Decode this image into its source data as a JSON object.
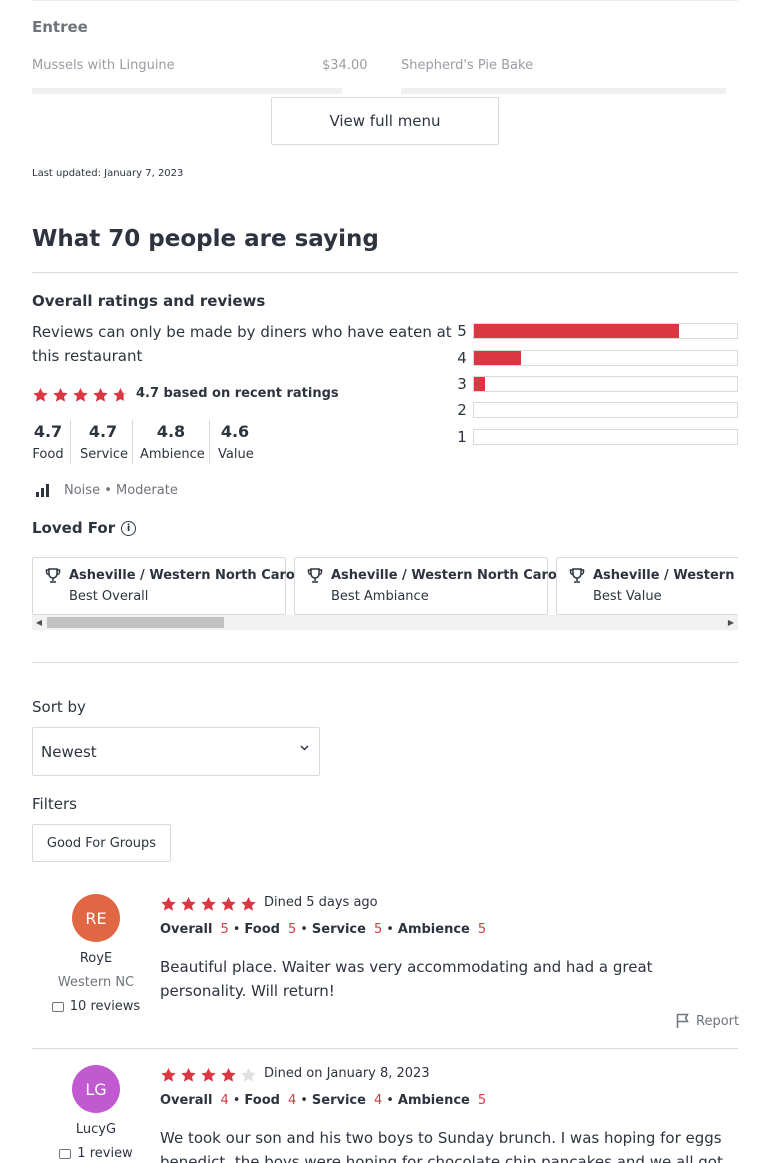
{
  "menu": {
    "section": "Entree",
    "items": [
      {
        "name": "Mussels with Linguine",
        "price": "$34.00"
      },
      {
        "name": "Shepherd's Pie Bake",
        "price": ""
      }
    ],
    "view_full_menu": "View full menu",
    "last_updated": "Last updated: January 7, 2023"
  },
  "reviews_summary": {
    "heading": "What 70 people are saying",
    "overall_title": "Overall ratings and reviews",
    "note": "Reviews can only be made by diners who have eaten at this restaurant",
    "overall_rating": 4.7,
    "rating_text": "4.7 based on recent ratings",
    "sub_ratings": [
      {
        "value": "4.7",
        "label": "Food"
      },
      {
        "value": "4.7",
        "label": "Service"
      },
      {
        "value": "4.8",
        "label": "Ambience"
      },
      {
        "value": "4.6",
        "label": "Value"
      }
    ],
    "noise_label": "Noise",
    "noise_value": "• Moderate",
    "distribution": [
      {
        "stars": "5",
        "fraction": 0.78
      },
      {
        "stars": "4",
        "fraction": 0.18
      },
      {
        "stars": "3",
        "fraction": 0.04
      },
      {
        "stars": "2",
        "fraction": 0
      },
      {
        "stars": "1",
        "fraction": 0
      }
    ]
  },
  "loved_for": {
    "title": "Loved For",
    "cards": [
      {
        "region": "Asheville / Western North Carolina",
        "award": "Best Overall"
      },
      {
        "region": "Asheville / Western North Carolina",
        "award": "Best Ambiance"
      },
      {
        "region": "Asheville / Western North Carolina",
        "award": "Best Value"
      }
    ]
  },
  "sort": {
    "label": "Sort by",
    "value": "Newest"
  },
  "filters": {
    "label": "Filters",
    "chips": [
      "Good For Groups"
    ]
  },
  "reviews": [
    {
      "initials": "RE",
      "avatar_color": "#e06644",
      "name": "RoyE",
      "location": "Western NC",
      "review_count": "10 reviews",
      "stars": 5,
      "dined": "Dined 5 days ago",
      "scores": {
        "overall": "5",
        "food": "5",
        "service": "5",
        "ambience": "5"
      },
      "text": "Beautiful place. Waiter was very accommodating and had a great personality. Will return!",
      "report": "Report"
    },
    {
      "initials": "LG",
      "avatar_color": "#c159d1",
      "name": "LucyG",
      "location": "",
      "review_count": "1 review",
      "stars": 4,
      "dined": "Dined on January 8, 2023",
      "scores": {
        "overall": "4",
        "food": "4",
        "service": "4",
        "ambience": "5"
      },
      "text": "We took our son and his two boys to Sunday brunch. I was hoping for eggs benedict, the boys were hoping for chocolate chip pancakes and we all got what",
      "report": ""
    }
  ],
  "score_labels": {
    "overall": "Overall",
    "food": "Food",
    "service": "Service",
    "ambience": "Ambience"
  },
  "colors": {
    "accent": "#da3743",
    "text": "#2d333f",
    "muted": "#6f737b"
  }
}
